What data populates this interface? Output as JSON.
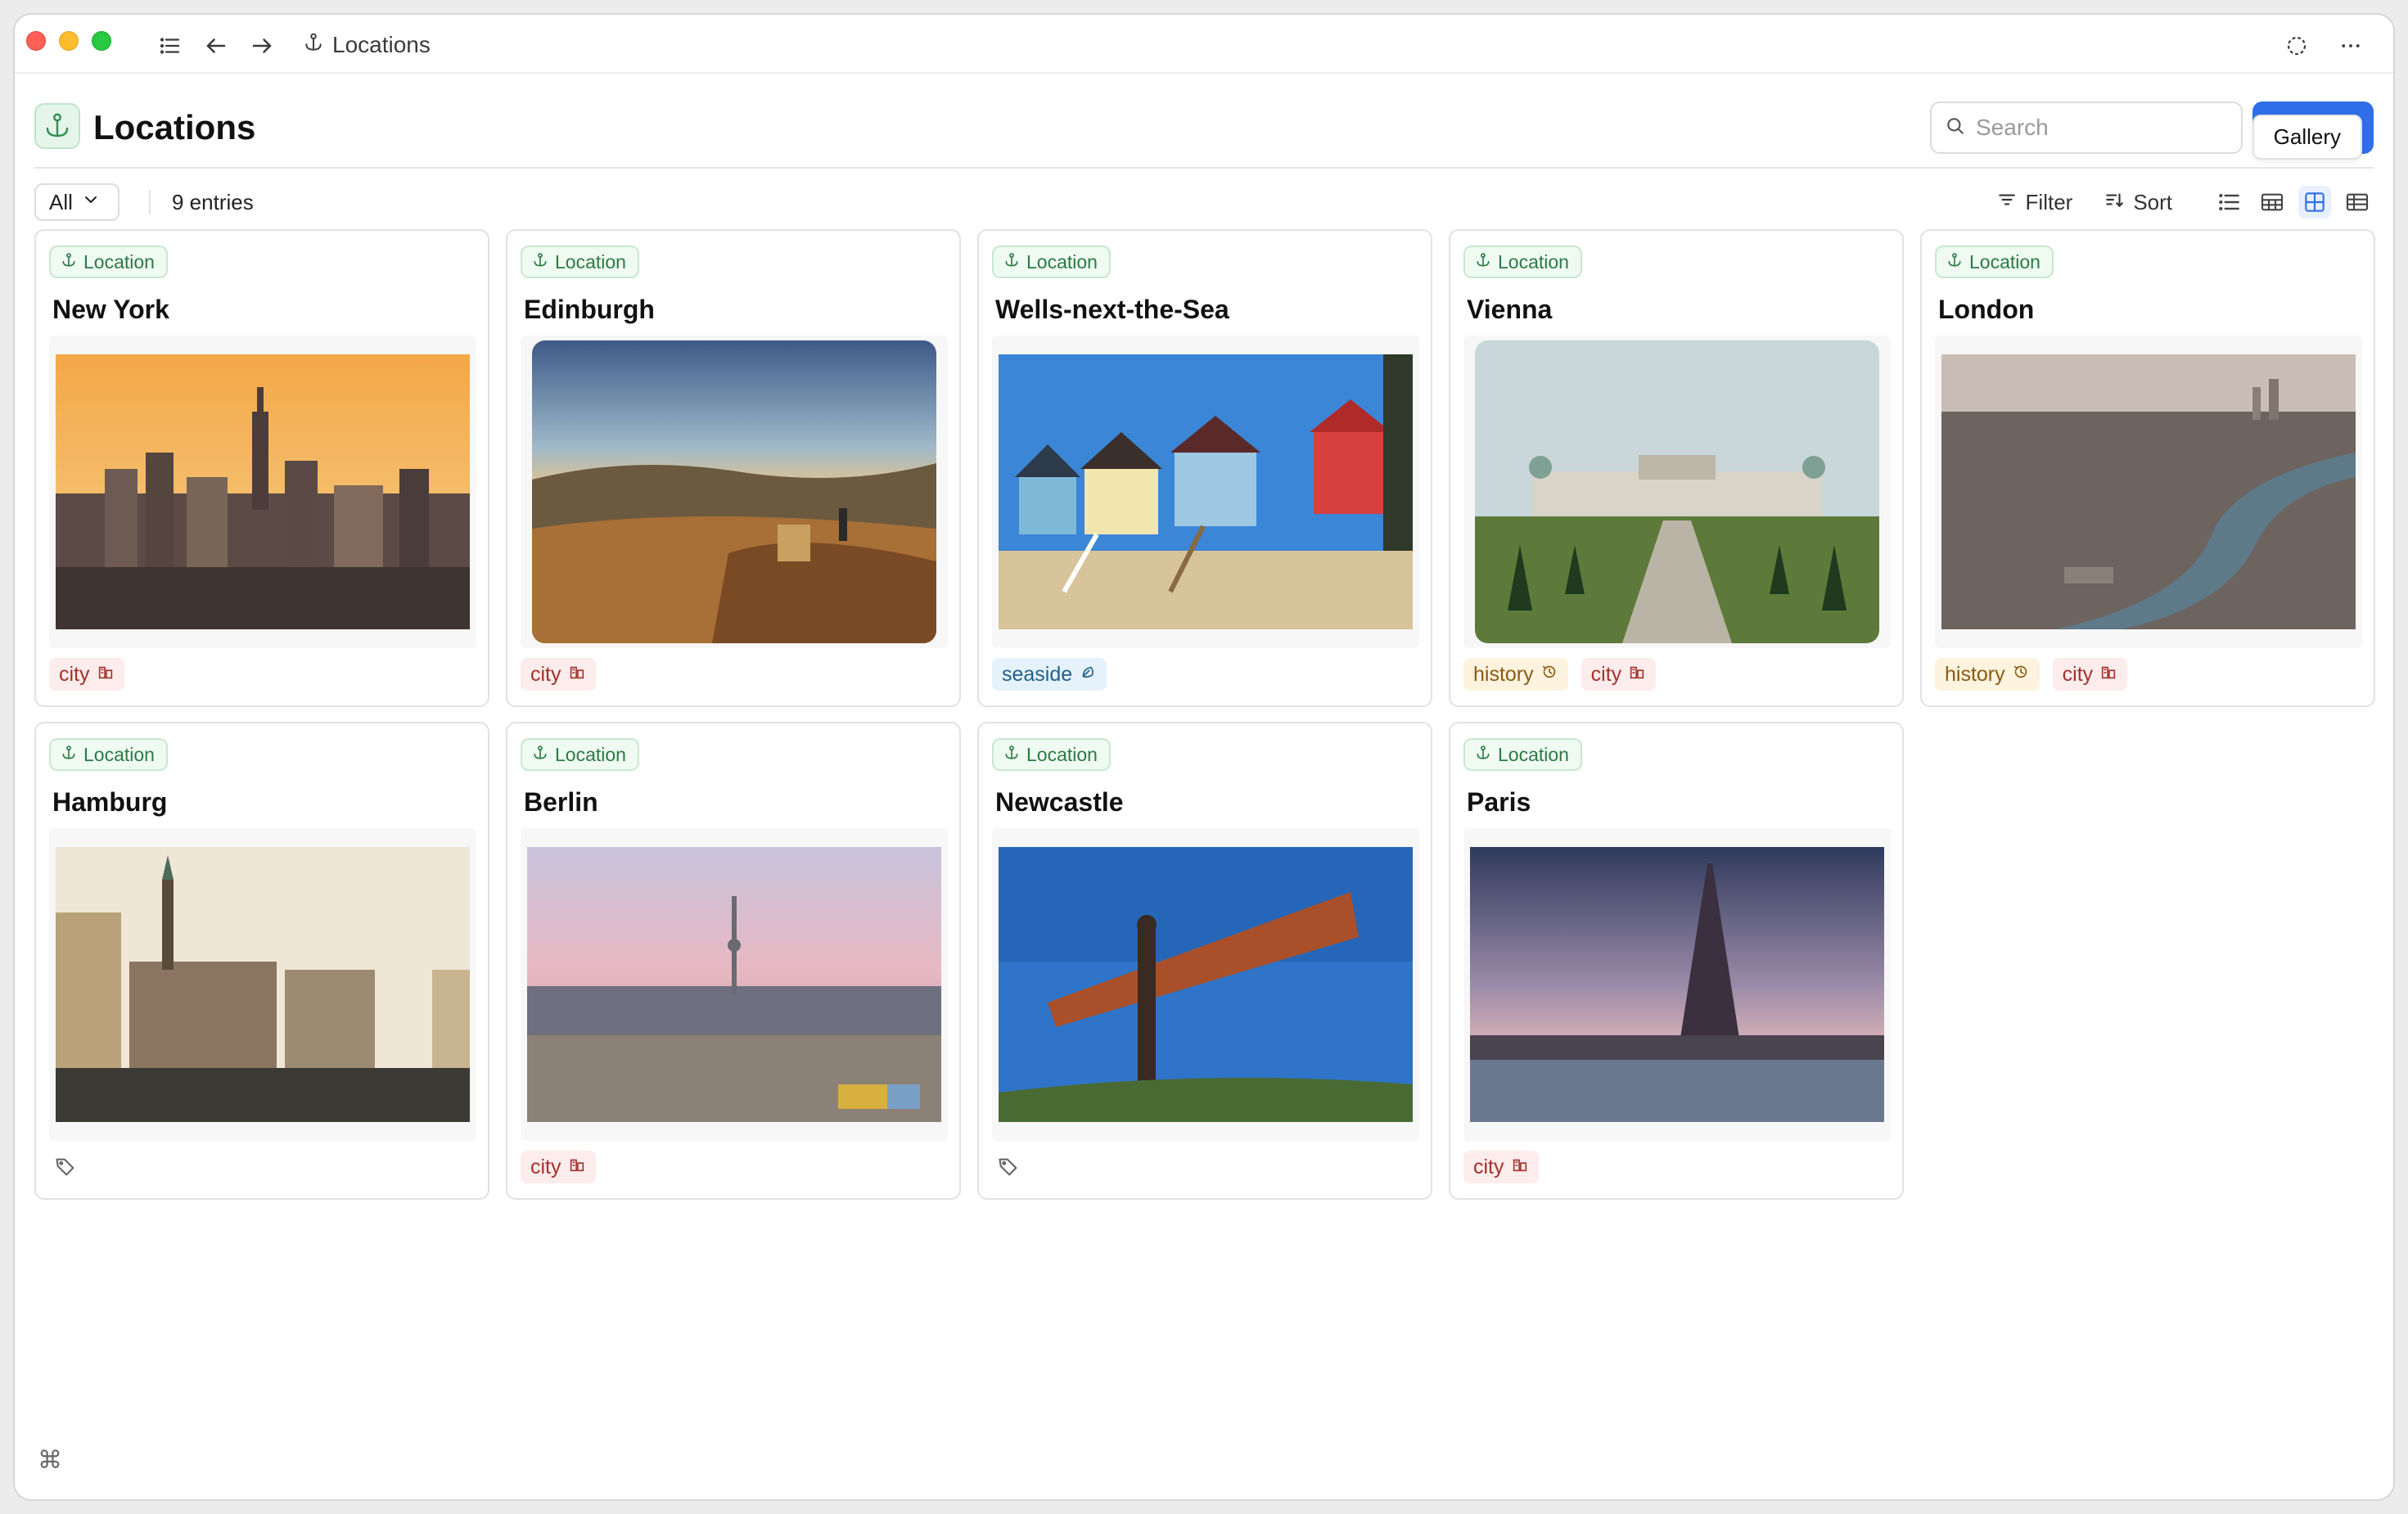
{
  "window": {
    "breadcrumb": "Locations"
  },
  "header": {
    "title": "Locations",
    "search_placeholder": "Search",
    "view_tooltip": "Gallery"
  },
  "toolbar": {
    "filter_scope": "All",
    "entries": "9 entries",
    "filter_label": "Filter",
    "sort_label": "Sort"
  },
  "cards": [
    {
      "type": "Location",
      "name": "New York",
      "image": "new-york-skyline-photo",
      "tags": [
        {
          "label": "city",
          "kind": "city",
          "icon": "building-icon"
        }
      ]
    },
    {
      "type": "Location",
      "name": "Edinburgh",
      "image": "edinburgh-hill-sunset-photo",
      "tags": [
        {
          "label": "city",
          "kind": "city",
          "icon": "building-icon"
        }
      ]
    },
    {
      "type": "Location",
      "name": "Wells-next-the-Sea",
      "image": "beach-huts-photo",
      "tags": [
        {
          "label": "seaside",
          "kind": "seaside",
          "icon": "shell-icon"
        }
      ]
    },
    {
      "type": "Location",
      "name": "Vienna",
      "image": "belvedere-palace-photo",
      "tags": [
        {
          "label": "history",
          "kind": "history",
          "icon": "history-icon"
        },
        {
          "label": "city",
          "kind": "city",
          "icon": "building-icon"
        }
      ]
    },
    {
      "type": "Location",
      "name": "London",
      "image": "london-thames-aerial-photo",
      "tags": [
        {
          "label": "history",
          "kind": "history",
          "icon": "history-icon"
        },
        {
          "label": "city",
          "kind": "city",
          "icon": "building-icon"
        }
      ]
    },
    {
      "type": "Location",
      "name": "Hamburg",
      "image": "hamburg-rathaus-photo",
      "tags": []
    },
    {
      "type": "Location",
      "name": "Berlin",
      "image": "berlin-tv-tower-photo",
      "tags": [
        {
          "label": "city",
          "kind": "city",
          "icon": "building-icon"
        }
      ]
    },
    {
      "type": "Location",
      "name": "Newcastle",
      "image": "angel-of-the-north-photo",
      "tags": []
    },
    {
      "type": "Location",
      "name": "Paris",
      "image": "eiffel-tower-photo",
      "tags": [
        {
          "label": "city",
          "kind": "city",
          "icon": "building-icon"
        }
      ]
    }
  ],
  "colors": {
    "accent": "#2f6fe8",
    "location_badge": "#2c7a45",
    "city_tag": "#a2322b",
    "history_tag": "#8a5a12",
    "seaside_tag": "#1f5f8b"
  },
  "footer": {
    "icon": "command-icon"
  }
}
